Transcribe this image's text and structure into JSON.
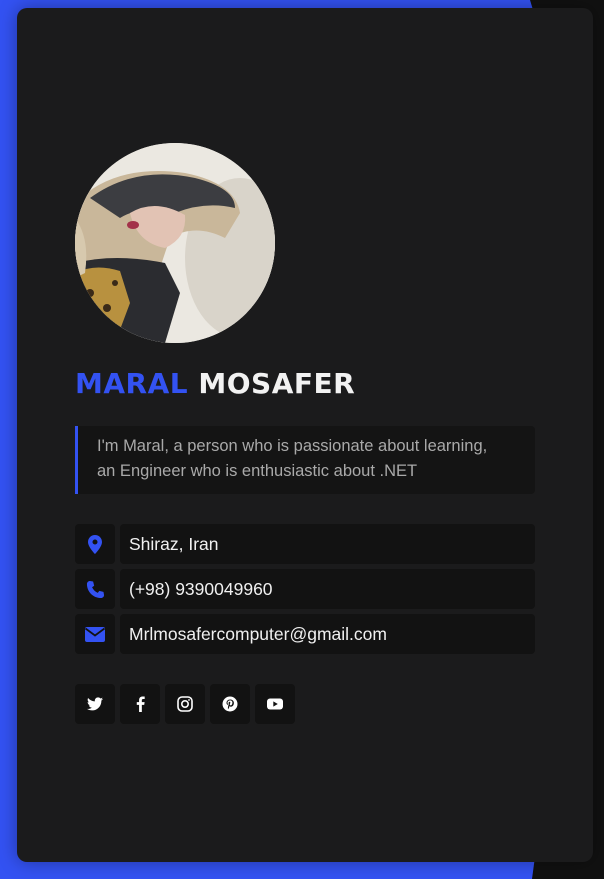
{
  "profile": {
    "first_name": "MARAL",
    "last_name": "MOSAFER",
    "bio_line1": "I'm Maral, a person who is passionate about learning,",
    "bio_line2": "an Engineer who is enthusiastic about .NET",
    "avatar_icon": "profile-photo"
  },
  "contacts": [
    {
      "icon": "location-pin-icon",
      "value": "Shiraz, Iran"
    },
    {
      "icon": "phone-icon",
      "value": "(+98) 9390049960"
    },
    {
      "icon": "envelope-icon",
      "value": "Mrlmosafercomputer@gmail.com"
    }
  ],
  "socials": [
    {
      "icon": "twitter-icon"
    },
    {
      "icon": "facebook-icon"
    },
    {
      "icon": "instagram-icon"
    },
    {
      "icon": "pinterest-icon"
    },
    {
      "icon": "youtube-icon"
    }
  ],
  "colors": {
    "accent": "#3352f2",
    "card": "#1b1b1c",
    "field": "#121212",
    "text": "#f0f0f0",
    "muted": "#a9a9a9"
  }
}
